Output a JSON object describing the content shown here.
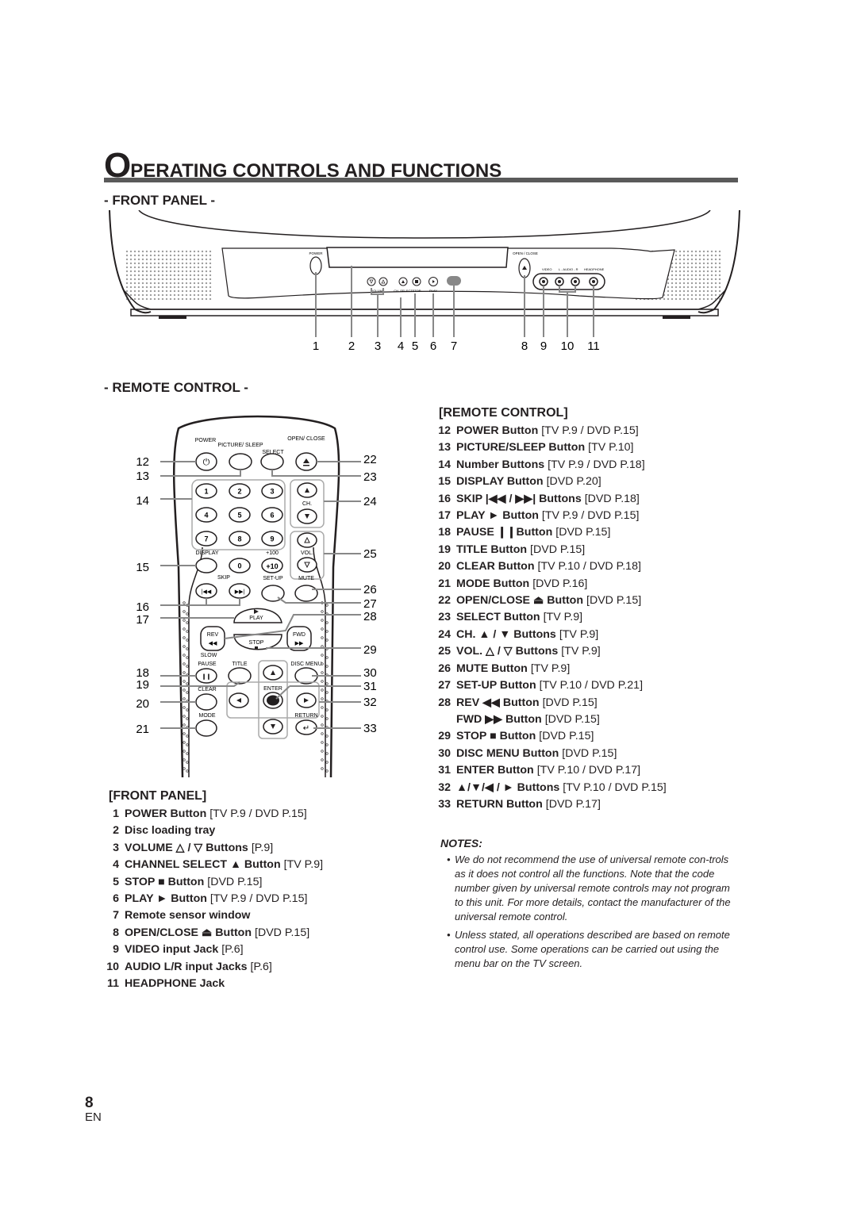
{
  "page": {
    "title_initial": "O",
    "title_rest": "PERATING CONTROLS AND FUNCTIONS",
    "page_number": "8",
    "language": "EN"
  },
  "front_panel_diagram": {
    "heading": "- FRONT PANEL -",
    "labels": {
      "power": "POWER",
      "open_close": "OPEN / CLOSE",
      "volume": "VOLUME",
      "ch_select": "CH. SELECT",
      "stop": "STOP",
      "play": "PLAY",
      "video": "VIDEO",
      "audio": "L - AUDIO - R",
      "headphone": "HEADPHONE"
    },
    "callouts": [
      "1",
      "2",
      "3",
      "4",
      "5",
      "6",
      "7",
      "8",
      "9",
      "10",
      "11"
    ]
  },
  "remote_diagram": {
    "heading": "- REMOTE CONTROL -",
    "labels": {
      "power": "POWER",
      "picture_sleep": "PICTURE/ SLEEP",
      "select": "SELECT",
      "open_close": "OPEN/ CLOSE",
      "ch": "CH.",
      "vol": "VOL.",
      "display": "DISPLAY",
      "plus100": "+100",
      "plus10": "+10",
      "skip": "SKIP",
      "setup": "SET-UP",
      "mute": "MUTE",
      "play": "PLAY",
      "rev": "REV",
      "fwd": "FWD",
      "stop": "STOP",
      "slow": "SLOW",
      "pause": "PAUSE",
      "title": "TITLE",
      "disc_menu": "DISC MENU",
      "enter": "ENTER",
      "clear": "CLEAR",
      "mode": "MODE",
      "return": "RETURN"
    },
    "digits": [
      "1",
      "2",
      "3",
      "4",
      "5",
      "6",
      "7",
      "8",
      "9",
      "0"
    ],
    "callouts_left": [
      "12",
      "13",
      "14",
      "15",
      "16",
      "17",
      "18",
      "19",
      "20",
      "21"
    ],
    "callouts_right": [
      "22",
      "23",
      "24",
      "25",
      "26",
      "27",
      "28",
      "29",
      "30",
      "31",
      "32",
      "33"
    ]
  },
  "front_panel_list": {
    "heading": "[FRONT PANEL]",
    "items": [
      {
        "num": "1",
        "label": "POWER Button",
        "ref": "[TV P.9 / DVD P.15]"
      },
      {
        "num": "2",
        "label": "Disc loading tray",
        "ref": ""
      },
      {
        "num": "3",
        "label": "VOLUME △ / ▽ Buttons",
        "ref": "[P.9]"
      },
      {
        "num": "4",
        "label": "CHANNEL SELECT ▲ Button",
        "ref": "[TV P.9]"
      },
      {
        "num": "5",
        "label": "STOP ■ Button",
        "ref": "[DVD P.15]"
      },
      {
        "num": "6",
        "label": "PLAY ► Button",
        "ref": "[TV P.9 / DVD P.15]"
      },
      {
        "num": "7",
        "label": "Remote sensor window",
        "ref": ""
      },
      {
        "num": "8",
        "label": "OPEN/CLOSE ⏏ Button",
        "ref": "[DVD P.15]"
      },
      {
        "num": "9",
        "label": "VIDEO input Jack",
        "ref": "[P.6]"
      },
      {
        "num": "10",
        "label": "AUDIO L/R input Jacks",
        "ref": "[P.6]"
      },
      {
        "num": "11",
        "label": "HEADPHONE Jack",
        "ref": ""
      }
    ]
  },
  "remote_list": {
    "heading": "[REMOTE CONTROL]",
    "items": [
      {
        "num": "12",
        "label": "POWER Button",
        "ref": "[TV P.9 / DVD P.15]"
      },
      {
        "num": "13",
        "label": "PICTURE/SLEEP Button",
        "ref": "[TV P.10]"
      },
      {
        "num": "14",
        "label": "Number Buttons",
        "ref": "[TV P.9 / DVD P.18]"
      },
      {
        "num": "15",
        "label": "DISPLAY Button",
        "ref": "[DVD P.20]"
      },
      {
        "num": "16",
        "label": "SKIP |◀◀ / ▶▶| Buttons",
        "ref": "[DVD P.18]"
      },
      {
        "num": "17",
        "label": "PLAY ► Button",
        "ref": "[TV P.9 / DVD P.15]"
      },
      {
        "num": "18",
        "label": "PAUSE ❙❙Button",
        "ref": "[DVD P.15]"
      },
      {
        "num": "19",
        "label": "TITLE Button",
        "ref": "[DVD P.15]"
      },
      {
        "num": "20",
        "label": "CLEAR Button",
        "ref": "[TV P.10 / DVD P.18]"
      },
      {
        "num": "21",
        "label": "MODE Button",
        "ref": "[DVD P.16]"
      },
      {
        "num": "22",
        "label": "OPEN/CLOSE ⏏ Button",
        "ref": "[DVD P.15]"
      },
      {
        "num": "23",
        "label": "SELECT Button",
        "ref": "[TV P.9]"
      },
      {
        "num": "24",
        "label": "CH. ▲ / ▼ Buttons",
        "ref": "[TV P.9]"
      },
      {
        "num": "25",
        "label": "VOL. △ / ▽ Buttons",
        "ref": "[TV P.9]"
      },
      {
        "num": "26",
        "label": "MUTE Button",
        "ref": "[TV P.9]"
      },
      {
        "num": "27",
        "label": "SET-UP Button",
        "ref": "[TV P.10 / DVD P.21]"
      },
      {
        "num": "28",
        "label": "REV ◀◀ Button",
        "ref": "[DVD P.15]"
      },
      {
        "num": "",
        "label": "FWD ▶▶ Button",
        "ref": "[DVD P.15]"
      },
      {
        "num": "29",
        "label": "STOP ■ Button",
        "ref": "[DVD P.15]"
      },
      {
        "num": "30",
        "label": "DISC MENU Button",
        "ref": "[DVD P.15]"
      },
      {
        "num": "31",
        "label": "ENTER Button",
        "ref": "[TV P.10 / DVD P.17]"
      },
      {
        "num": "32",
        "label": "▲/▼/◀ / ► Buttons",
        "ref": "[TV P.10 / DVD P.15]"
      },
      {
        "num": "33",
        "label": "RETURN Button",
        "ref": "[DVD P.17]"
      }
    ]
  },
  "notes": {
    "heading": "NOTES:",
    "items": [
      "We do not recommend the use of universal remote con-trols as it does not control all the functions. Note that the code number given by universal remote controls may not program to this unit. For more details, contact the manufacturer of the universal remote control.",
      "Unless stated, all operations described are based on remote control use. Some operations can be carried out using the menu bar on the TV screen."
    ]
  }
}
